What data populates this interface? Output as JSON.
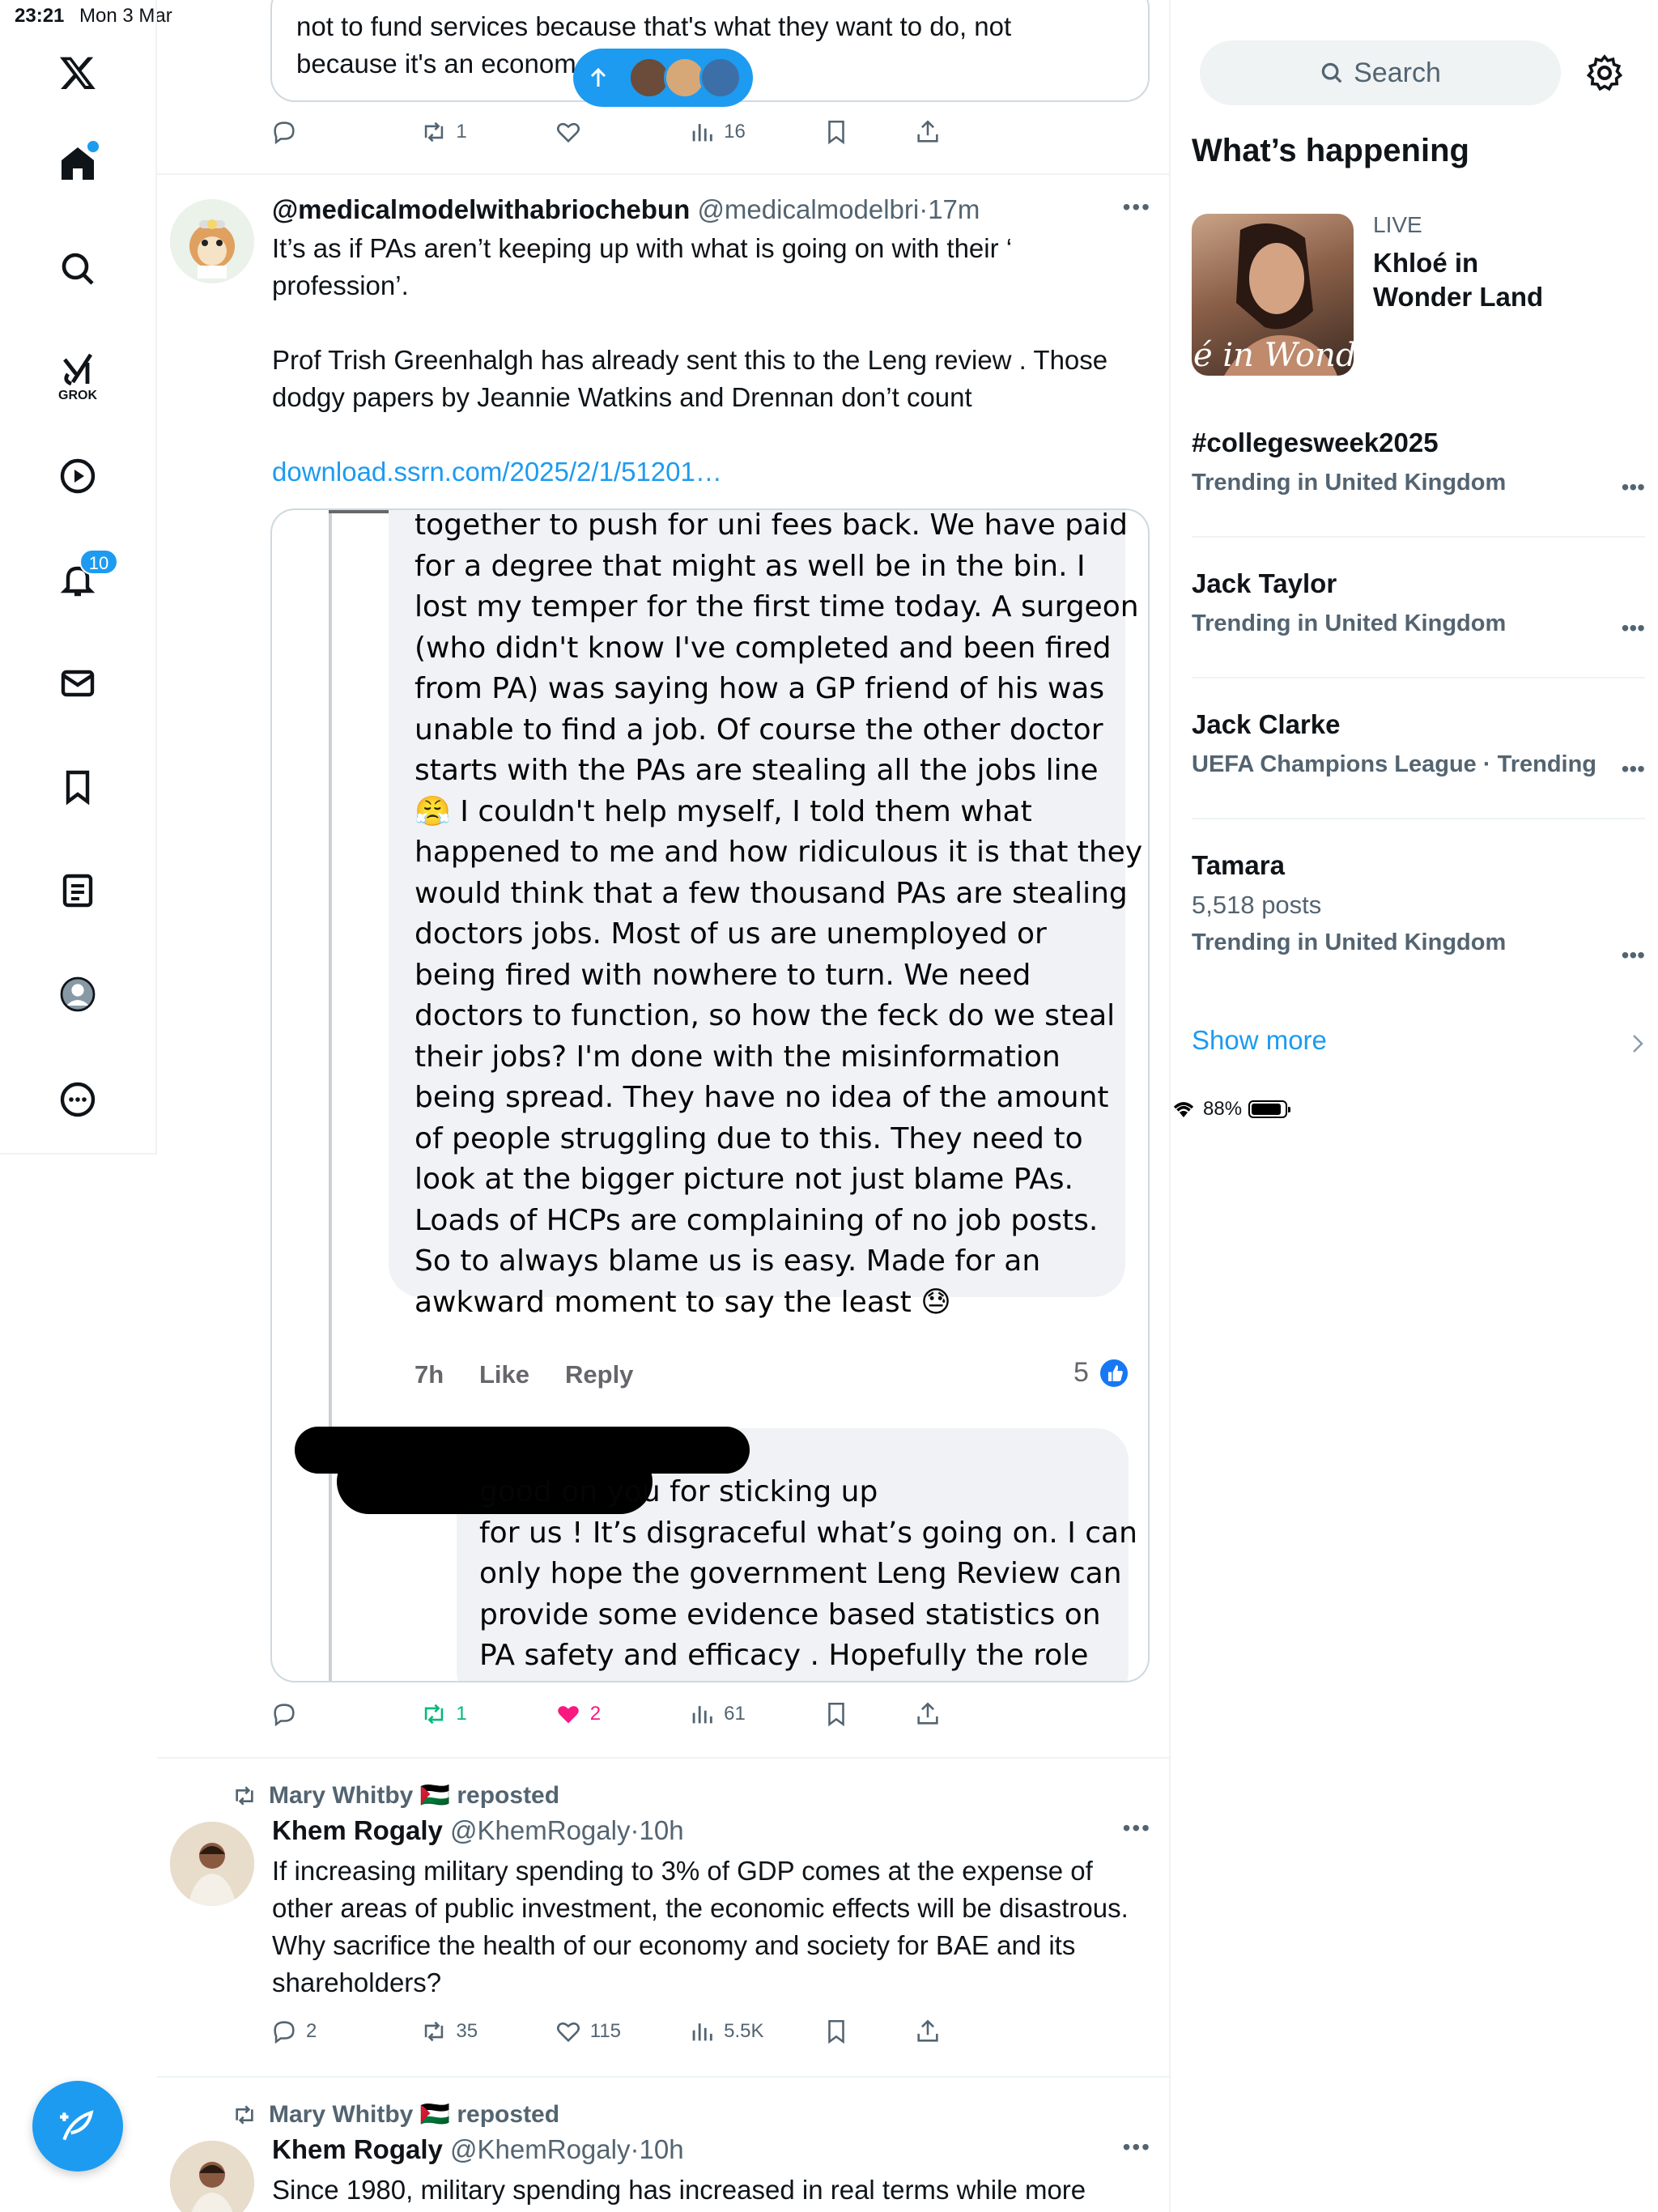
{
  "status_bar": {
    "time": "23:21",
    "date": "Mon 3 Mar",
    "battery": "88%"
  },
  "nav": {
    "grok_label": "GROK",
    "notifications_count": "10"
  },
  "tweet0": {
    "text_line1": "not to fund services because that's what they want to do, not",
    "text_line2": "because it's an econom",
    "replies": "",
    "retweets": "1",
    "likes": "",
    "views": "16"
  },
  "tweet1": {
    "display_name": "@medicalmodelwithabriochebun",
    "handle": "@medicalmodelbri",
    "sep": "·",
    "time": "17m",
    "text_p1": "It’s as if PAs aren’t keeping up with what is going on with their ‘ profession’.",
    "text_p2": "Prof Trish Greenhalgh has already sent this to the Leng review . Those dodgy papers by Jeannie Watkins and Drennan don’t count",
    "link": "download.ssrn.com/2025/2/1/51201…",
    "embed": {
      "comment1_lines": [
        "together to push for uni fees back.  We have paid",
        "for a degree that might as well be in the bin.  I",
        "lost my temper for the first time today.  A surgeon",
        "(who didn't know I've completed and been fired",
        "from PA) was saying how a GP friend of his was",
        "unable to find a job.  Of course the other doctor",
        "starts with the PAs are stealing all the jobs line",
        "😤 I couldn't help myself, I told them what",
        "happened to me and how ridiculous it is that they",
        "would think that a few thousand PAs are stealing",
        "doctors jobs.  Most of us are unemployed or",
        "being fired with nowhere to turn.  We need",
        "doctors to function, so how the feck do we steal",
        "their jobs?  I'm done with the misinformation",
        "being spread.  They have no idea of the amount",
        "of people struggling due to this.  They need to",
        "look at the bigger picture not just blame PAs.",
        "Loads of HCPs are complaining of no job posts.",
        "So to always blame us is easy.  Made for an",
        "awkward moment to say the least 😓"
      ],
      "meta_time": "7h",
      "meta_like": "Like",
      "meta_reply": "Reply",
      "reaction_count": "5",
      "comment2_lines": [
        "good on you for sticking up",
        "for us ! It’s disgraceful what’s going on. I can",
        "only hope the government Leng Review can",
        "provide some evidence based statistics on",
        "PA safety and efficacy . Hopefully  the role"
      ]
    },
    "replies": "",
    "retweets": "1",
    "likes": "2",
    "views": "61"
  },
  "tweet2": {
    "repost_by": "Mary Whitby 🇵🇸 reposted",
    "display_name": "Khem Rogaly",
    "handle": "@KhemRogaly",
    "sep": "·",
    "time": "10h",
    "text": "If increasing military spending to 3% of GDP comes at the expense of other areas of public investment, the economic effects will be disastrous. Why sacrifice the health of our economy and society for BAE and its shareholders?",
    "replies": "2",
    "retweets": "35",
    "likes": "115",
    "views": "5.5K"
  },
  "tweet3": {
    "repost_by": "Mary Whitby 🇵🇸 reposted",
    "display_name": "Khem Rogaly",
    "handle": "@KhemRogaly",
    "sep": "·",
    "time": "10h",
    "text": "Since 1980, military spending has increased in real terms while more"
  },
  "sidebar": {
    "search_placeholder": "Search",
    "section_title": "What’s happening",
    "live": {
      "label": "LIVE",
      "title": "Khloé in Wonder Land",
      "thumb_text": "é in Wonder L"
    },
    "trends": [
      {
        "name": "#collegesweek2025",
        "meta": "Trending in United Kingdom"
      },
      {
        "name": "Jack Taylor",
        "meta": "Trending in United Kingdom"
      },
      {
        "name": "Jack Clarke",
        "meta": "UEFA Champions League · Trending"
      },
      {
        "name": "Tamara",
        "posts": "5,518 posts",
        "meta": "Trending in United Kingdom"
      }
    ],
    "show_more": "Show more"
  }
}
